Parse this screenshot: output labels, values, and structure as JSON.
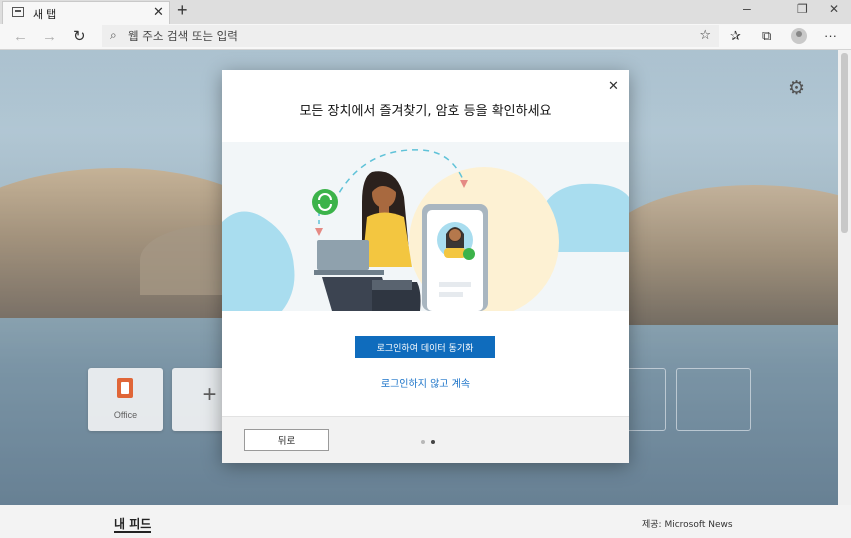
{
  "browser": {
    "tab": {
      "title": "새 탭"
    },
    "address_bar": {
      "placeholder": "웹 주소 검색 또는 입력"
    }
  },
  "new_tab_page": {
    "quick_links": [
      {
        "label": "Office"
      }
    ],
    "feed": {
      "title": "내 피드",
      "provider": "제공: Microsoft News"
    }
  },
  "modal": {
    "title": "모든 장치에서 즐겨찾기, 암호 등을 확인하세요",
    "primary_button": "로그인하여 데이터 동기화",
    "secondary_link": "로그인하지 않고 계속",
    "back_button": "뒤로",
    "pagination": {
      "total": 2,
      "current": 2
    }
  },
  "colors": {
    "primary": "#0f6cbd",
    "link": "#1a73c8",
    "office_brand": "#d83b01",
    "sync_green": "#3cb34a"
  },
  "icons": [
    "browser-tab-icon",
    "close-icon",
    "plus-icon",
    "minimize-icon",
    "restore-icon",
    "back-icon",
    "forward-icon",
    "reload-icon",
    "search-icon",
    "star-icon",
    "favorites-icon",
    "collections-icon",
    "profile-icon",
    "more-icon",
    "gear-icon",
    "office-icon",
    "sync-icon"
  ]
}
